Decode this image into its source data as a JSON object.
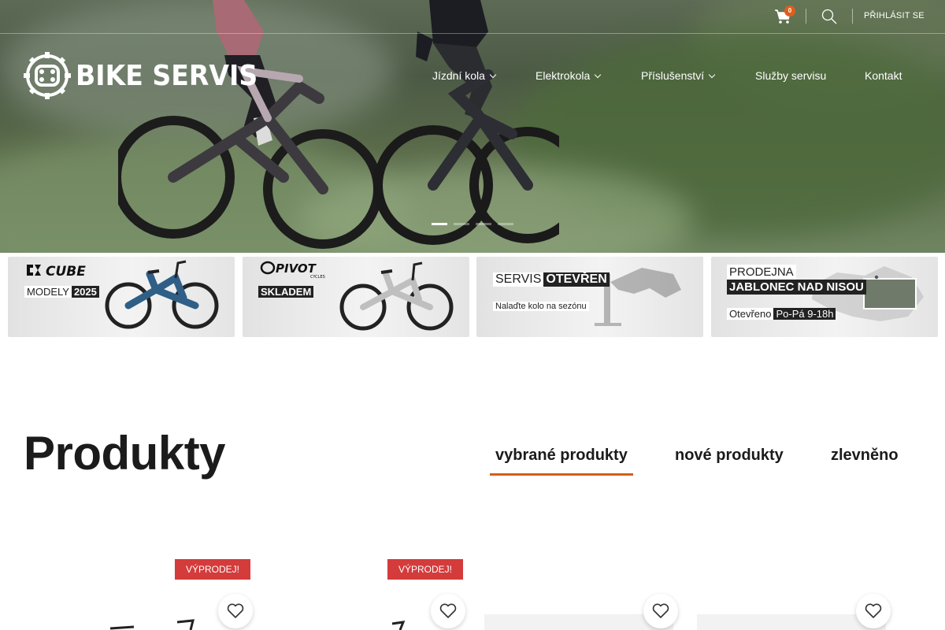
{
  "topbar": {
    "cart_count": "0",
    "login_label": "PŘIHLÁSIT SE"
  },
  "brand": {
    "name": "BIKE SERVIS"
  },
  "nav": {
    "items": [
      {
        "label": "Jízdní kola",
        "has_dropdown": true
      },
      {
        "label": "Elektrokola",
        "has_dropdown": true
      },
      {
        "label": "Příslušenství",
        "has_dropdown": true
      },
      {
        "label": "Služby servisu",
        "has_dropdown": false
      },
      {
        "label": "Kontakt",
        "has_dropdown": false
      }
    ]
  },
  "slider": {
    "slide_count": 4,
    "active_slide": 1
  },
  "banners": [
    {
      "brand_logo": "CUBE",
      "light": "MODELY",
      "dark": "2025"
    },
    {
      "brand_logo": "PIVOT",
      "brand_sub": "CYCLES",
      "dark": "SKLADEM"
    },
    {
      "light": "SERVIS",
      "dark": "OTEVŘEN",
      "sub": "Nalaďte kolo na sezónu"
    },
    {
      "light": "PRODEJNA",
      "dark": "JABLONEC NAD NISOU",
      "sub_light": "Otevřeno",
      "sub_dark": "Po-Pá 9-18h"
    }
  ],
  "products": {
    "title": "Produkty",
    "tabs": [
      {
        "label": "vybrané produkty",
        "active": true
      },
      {
        "label": "nové produkty",
        "active": false
      },
      {
        "label": "zlevněno",
        "active": false
      }
    ],
    "sale_badge": "VÝPRODEJ!"
  },
  "colors": {
    "accent": "#d35f1a",
    "sale": "#d43b3b",
    "badge": "#e05d1d"
  }
}
